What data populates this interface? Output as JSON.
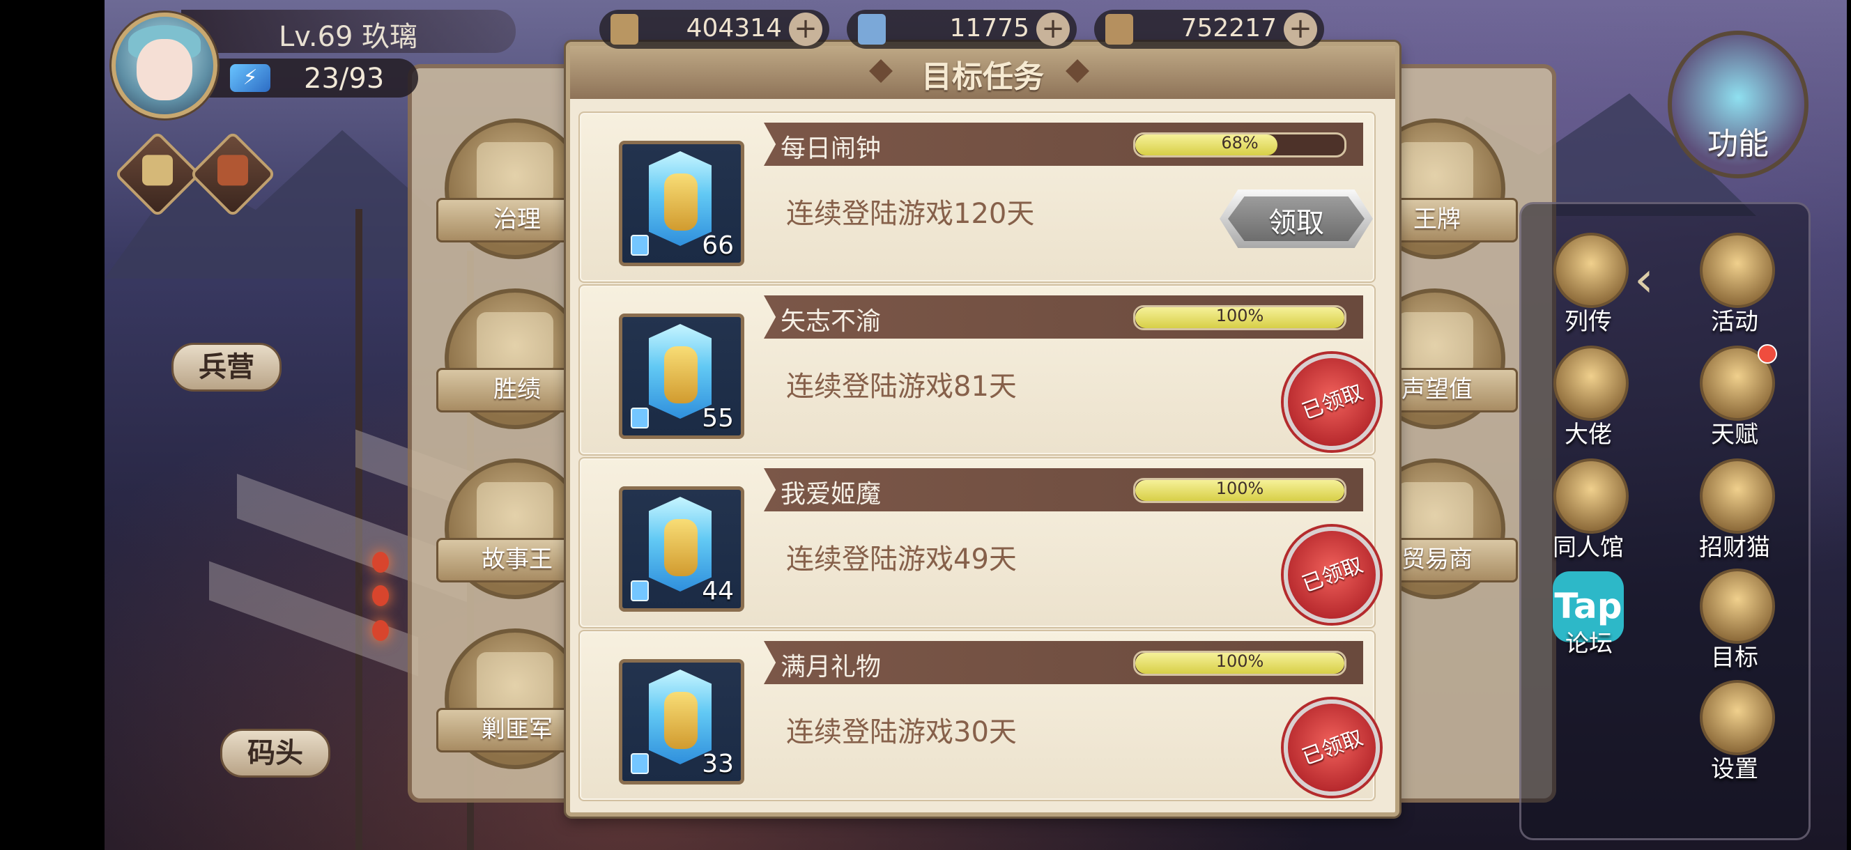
{
  "hud": {
    "level_text": "Lv.69 玖璃",
    "energy_text": "23/93",
    "currencies": [
      {
        "value": "404314",
        "plus": "+"
      },
      {
        "value": "11775",
        "plus": "+"
      },
      {
        "value": "752217",
        "plus": "+"
      }
    ]
  },
  "map_labels": {
    "barracks": "兵营",
    "dock": "码头"
  },
  "back_panel": {
    "medals": [
      "治理",
      "胜绩",
      "故事王",
      "剿匪军",
      "王牌",
      "声望值",
      "贸易商"
    ]
  },
  "right_panel": {
    "function_label": "功能",
    "items": [
      "列传",
      "活动",
      "大佬",
      "天赋",
      "同人馆",
      "招财猫",
      "论坛",
      "目标",
      "设置"
    ],
    "tap_label": "Tap"
  },
  "dialog": {
    "title": "目标任务",
    "tasks": [
      {
        "name": "每日闹钟",
        "progress_text": "68%",
        "progress_value": 68,
        "description": "连续登陆游戏120天",
        "reward_count": "66",
        "action_label": "领取",
        "claimed": false
      },
      {
        "name": "矢志不渝",
        "progress_text": "100%",
        "progress_value": 100,
        "description": "连续登陆游戏81天",
        "reward_count": "55",
        "action_label": "已领取",
        "claimed": true
      },
      {
        "name": "我爱姬魔",
        "progress_text": "100%",
        "progress_value": 100,
        "description": "连续登陆游戏49天",
        "reward_count": "44",
        "action_label": "已领取",
        "claimed": true
      },
      {
        "name": "满月礼物",
        "progress_text": "100%",
        "progress_value": 100,
        "description": "连续登陆游戏30天",
        "reward_count": "33",
        "action_label": "已领取",
        "claimed": true
      }
    ]
  }
}
